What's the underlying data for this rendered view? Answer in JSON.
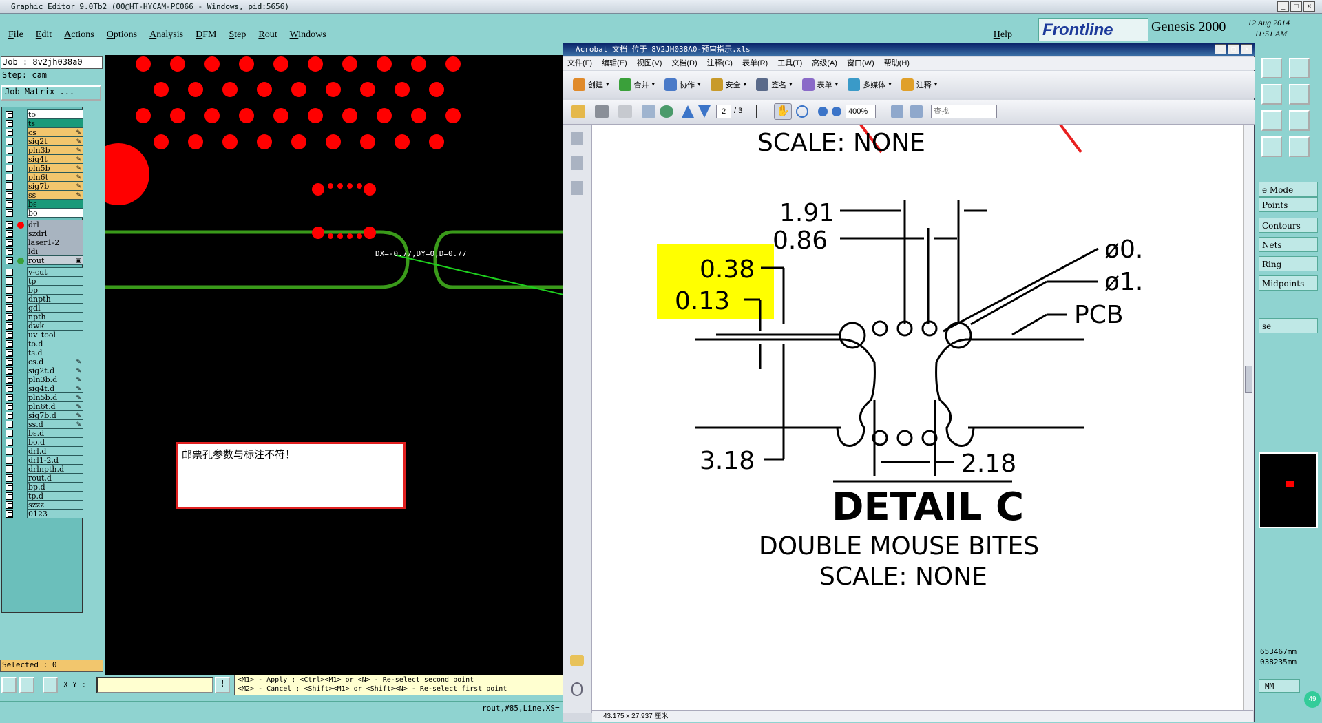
{
  "window": {
    "title": "Graphic Editor 9.0Tb2 (00@HT-HYCAM-PC066 - Windows, pid:5656)"
  },
  "menubar": {
    "items": [
      "File",
      "Edit",
      "Actions",
      "Options",
      "Analysis",
      "DFM",
      "Step",
      "Rout",
      "Windows"
    ],
    "help": "Help"
  },
  "brand": {
    "logo": "Frontline",
    "product": "Genesis 2000",
    "date": "12 Aug 2014",
    "time": "11:51 AM"
  },
  "job": {
    "job_label": "Job : 8v2jh038a0",
    "step_label": "Step: cam",
    "matrix_button": "Job Matrix ..."
  },
  "layers": [
    {
      "name": "to",
      "bg": "#ffffff",
      "dot": "",
      "mk": ""
    },
    {
      "name": "ts",
      "bg": "#1a9a7a",
      "dot": "",
      "mk": ""
    },
    {
      "name": "cs",
      "bg": "#f2c66d",
      "dot": "",
      "mk": "✎"
    },
    {
      "name": "sig2t",
      "bg": "#f2c66d",
      "dot": "",
      "mk": "✎"
    },
    {
      "name": "pln3b",
      "bg": "#f2c66d",
      "dot": "",
      "mk": "✎"
    },
    {
      "name": "sig4t",
      "bg": "#f2c66d",
      "dot": "",
      "mk": "✎"
    },
    {
      "name": "pln5b",
      "bg": "#f2c66d",
      "dot": "",
      "mk": "✎"
    },
    {
      "name": "pln6t",
      "bg": "#f2c66d",
      "dot": "",
      "mk": "✎"
    },
    {
      "name": "sig7b",
      "bg": "#f2c66d",
      "dot": "",
      "mk": "✎"
    },
    {
      "name": "ss",
      "bg": "#f2c66d",
      "dot": "",
      "mk": "✎"
    },
    {
      "name": "bs",
      "bg": "#1a9a7a",
      "dot": "",
      "mk": ""
    },
    {
      "name": "bo",
      "bg": "#ffffff",
      "dot": "",
      "mk": ""
    },
    {
      "name": "drl",
      "bg": "#a8b4c0",
      "dot": "#ff0000",
      "mk": ""
    },
    {
      "name": "szdrl",
      "bg": "#a8b4c0",
      "dot": "",
      "mk": ""
    },
    {
      "name": "laser1-2",
      "bg": "#a8b4c0",
      "dot": "",
      "mk": ""
    },
    {
      "name": "ldi",
      "bg": "#a8b4c0",
      "dot": "",
      "mk": ""
    },
    {
      "name": "rout",
      "bg": "#c8d0d8",
      "dot": "#3aa03a",
      "mk": "▣"
    },
    {
      "name": "v-cut",
      "bg": "#8fd3d0",
      "dot": "",
      "mk": ""
    },
    {
      "name": "tp",
      "bg": "#8fd3d0",
      "dot": "",
      "mk": ""
    },
    {
      "name": "bp",
      "bg": "#8fd3d0",
      "dot": "",
      "mk": ""
    },
    {
      "name": "dnpth",
      "bg": "#8fd3d0",
      "dot": "",
      "mk": ""
    },
    {
      "name": "gdl",
      "bg": "#8fd3d0",
      "dot": "",
      "mk": ""
    },
    {
      "name": "npth",
      "bg": "#8fd3d0",
      "dot": "",
      "mk": ""
    },
    {
      "name": "dwk",
      "bg": "#8fd3d0",
      "dot": "",
      "mk": ""
    },
    {
      "name": "uv_tool",
      "bg": "#8fd3d0",
      "dot": "",
      "mk": ""
    },
    {
      "name": "to.d",
      "bg": "#8fd3d0",
      "dot": "",
      "mk": ""
    },
    {
      "name": "ts.d",
      "bg": "#8fd3d0",
      "dot": "",
      "mk": ""
    },
    {
      "name": "cs.d",
      "bg": "#8fd3d0",
      "dot": "",
      "mk": "✎"
    },
    {
      "name": "sig2t.d",
      "bg": "#8fd3d0",
      "dot": "",
      "mk": "✎"
    },
    {
      "name": "pln3b.d",
      "bg": "#8fd3d0",
      "dot": "",
      "mk": "✎"
    },
    {
      "name": "sig4t.d",
      "bg": "#8fd3d0",
      "dot": "",
      "mk": "✎"
    },
    {
      "name": "pln5b.d",
      "bg": "#8fd3d0",
      "dot": "",
      "mk": "✎"
    },
    {
      "name": "pln6t.d",
      "bg": "#8fd3d0",
      "dot": "",
      "mk": "✎"
    },
    {
      "name": "sig7b.d",
      "bg": "#8fd3d0",
      "dot": "",
      "mk": "✎"
    },
    {
      "name": "ss.d",
      "bg": "#8fd3d0",
      "dot": "",
      "mk": "✎"
    },
    {
      "name": "bs.d",
      "bg": "#8fd3d0",
      "dot": "",
      "mk": ""
    },
    {
      "name": "bo.d",
      "bg": "#8fd3d0",
      "dot": "",
      "mk": ""
    },
    {
      "name": "drl.d",
      "bg": "#8fd3d0",
      "dot": "",
      "mk": ""
    },
    {
      "name": "drl1-2.d",
      "bg": "#8fd3d0",
      "dot": "",
      "mk": ""
    },
    {
      "name": "drlnpth.d",
      "bg": "#8fd3d0",
      "dot": "",
      "mk": ""
    },
    {
      "name": "rout.d",
      "bg": "#8fd3d0",
      "dot": "",
      "mk": ""
    },
    {
      "name": "bp.d",
      "bg": "#8fd3d0",
      "dot": "",
      "mk": ""
    },
    {
      "name": "tp.d",
      "bg": "#8fd3d0",
      "dot": "",
      "mk": ""
    },
    {
      "name": "szzz",
      "bg": "#8fd3d0",
      "dot": "",
      "mk": ""
    },
    {
      "name": "0123",
      "bg": "#8fd3d0",
      "dot": "",
      "mk": ""
    }
  ],
  "canvas": {
    "measure_label": "DX=-0.77,DY=0,D=0.77",
    "note": "邮票孔参数与标注不符！"
  },
  "status": {
    "selected": "Selected : 0",
    "xy_label": "X Y :",
    "hint_line1": "<M1> - Apply  ; <Ctrl><M1> or <N> - Re-select second point",
    "hint_line2": "<M2> - Cancel ; <Shift><M1> or <Shift><N> - Re-select first point",
    "bottom": "rout,#85,Line,XS="
  },
  "acrobat": {
    "title": "Acrobat 文档 位于 8V2JH038A0-预审指示.xls",
    "menu": [
      "文件(F)",
      "编辑(E)",
      "视图(V)",
      "文档(D)",
      "注释(C)",
      "表单(R)",
      "工具(T)",
      "高级(A)",
      "窗口(W)",
      "帮助(H)"
    ],
    "tools": [
      "创建",
      "合并",
      "协作",
      "安全",
      "签名",
      "表单",
      "多媒体",
      "注释"
    ],
    "page_current": "2",
    "page_total": "/ 3",
    "zoom": "400%",
    "search_placeholder": "查找",
    "page_size": "43.175 x 27.937 厘米"
  },
  "drawing": {
    "top_text": "SCALE:  NONE",
    "dim_191": "1.91",
    "dim_086": "0.86",
    "dim_038": "0.38",
    "dim_013": "0.13",
    "dia_a": "ø0.",
    "dia_b": "ø1.",
    "pcb": "PCB",
    "dim_318": "3.18",
    "dim_218": "2.18",
    "detail": "DETAIL  C",
    "subtitle": "DOUBLE  MOUSE  BITES",
    "scale": "SCALE:  NONE"
  },
  "rightpanel": {
    "items": [
      "e Mode",
      "Points",
      "Contours",
      "Nets",
      "Ring",
      "Midpoints"
    ],
    "se": "se",
    "readout1": "653467mm",
    "readout2": "038235mm",
    "unit": "MM",
    "badge": "49"
  }
}
